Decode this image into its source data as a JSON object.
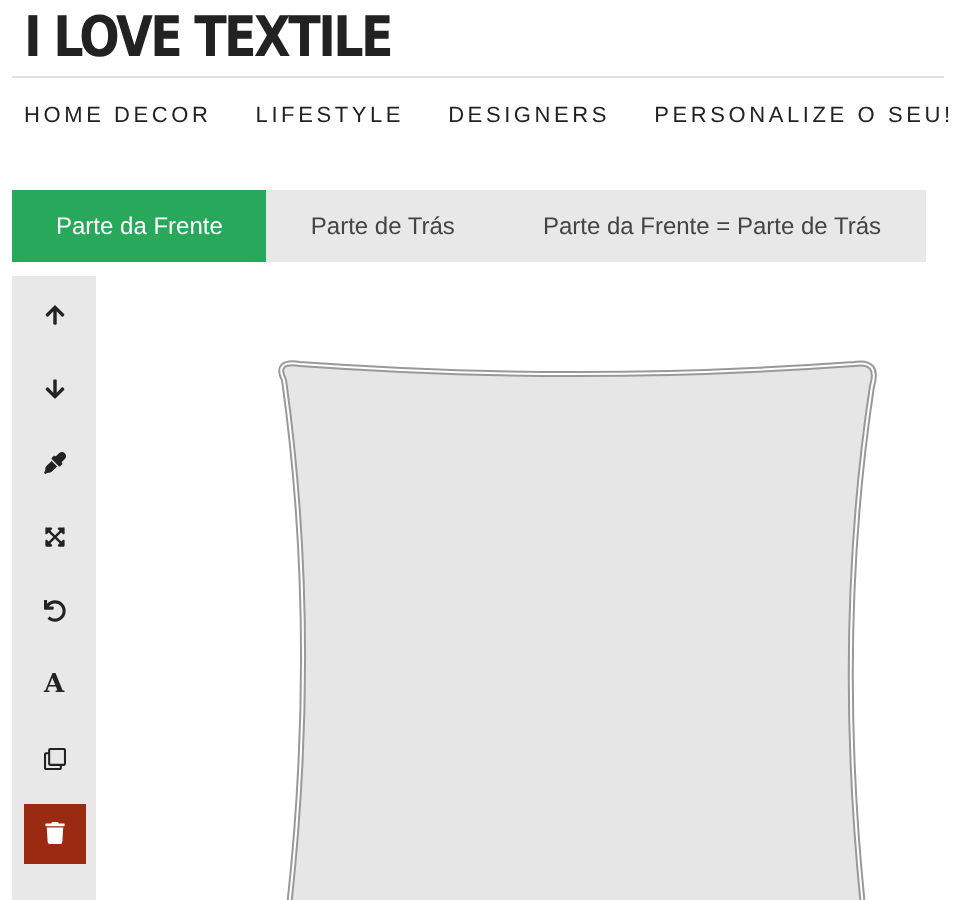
{
  "logo": "I LOVE TEXTILE",
  "nav": [
    "HOME DECOR",
    "LIFESTYLE",
    "DESIGNERS",
    "PERSONALIZE O SEU!"
  ],
  "tabs": [
    {
      "label": "Parte da Frente",
      "selected": true
    },
    {
      "label": "Parte de Trás",
      "selected": false
    },
    {
      "label": "Parte da Frente = Parte de Trás",
      "selected": false
    }
  ],
  "tools": [
    {
      "kind": "up"
    },
    {
      "kind": "down"
    },
    {
      "kind": "eyedropper"
    },
    {
      "kind": "expand"
    },
    {
      "kind": "rotate"
    },
    {
      "kind": "text",
      "label": "A"
    },
    {
      "kind": "copy"
    },
    {
      "kind": "delete"
    }
  ]
}
